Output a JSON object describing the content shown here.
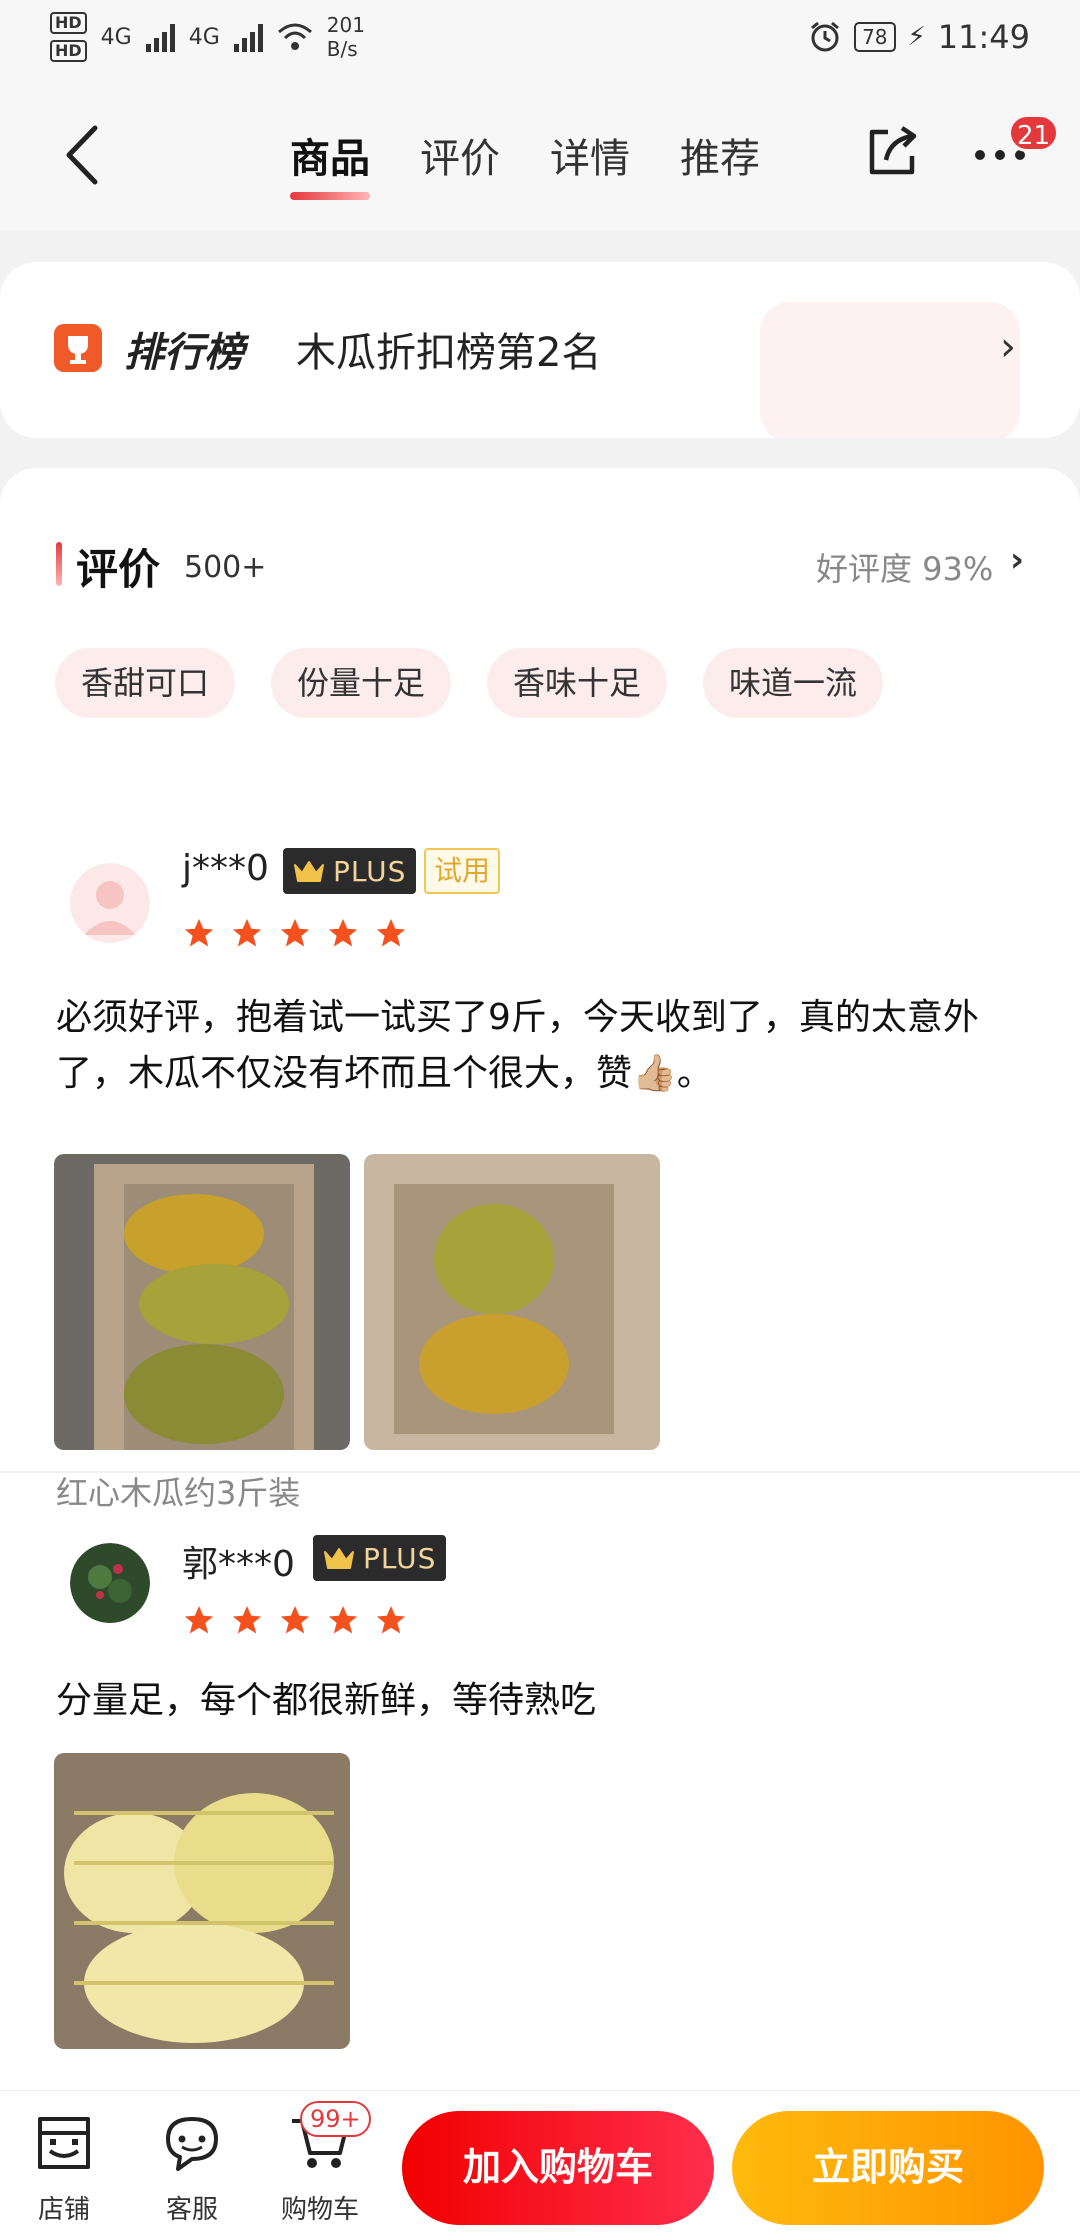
{
  "status_bar": {
    "hd1": "HD",
    "hd2": "HD",
    "sim1": "4G",
    "sim2": "4G",
    "net_speed_value": "201",
    "net_speed_unit": "B/s",
    "battery": "78",
    "time": "11:49",
    "icons": [
      "signal-icon",
      "wifi-icon",
      "alarm-icon",
      "battery-icon",
      "charging-icon"
    ]
  },
  "nav": {
    "tabs": [
      {
        "label": "商品",
        "active": true
      },
      {
        "label": "评价",
        "active": false
      },
      {
        "label": "详情",
        "active": false
      },
      {
        "label": "推荐",
        "active": false
      }
    ],
    "more_badge": "21",
    "icons": [
      "back-icon",
      "share-icon",
      "more-icon"
    ]
  },
  "ranking": {
    "logo": "排行榜",
    "text": "木瓜折扣榜第2名",
    "icons": [
      "trophy-icon",
      "chevron-right-icon"
    ]
  },
  "reviews_section": {
    "title": "评价",
    "count": "500+",
    "good_rate": "好评度 93%",
    "tags": [
      "香甜可口",
      "份量十足",
      "香味十足",
      "味道一流"
    ]
  },
  "reviews": [
    {
      "username": "j***0",
      "plus": "PLUS",
      "trial": "试用",
      "stars": 5,
      "text": "必须好评，抱着试一试买了9斤，今天收到了，真的太意外了，木瓜不仅没有坏而且个很大，赞👍🏼。",
      "spec": "红心木瓜约3斤装",
      "photos": 2
    },
    {
      "username": "郭***0",
      "plus": "PLUS",
      "stars": 5,
      "text": "分量足，每个都很新鲜，等待熟吃",
      "photos": 1
    }
  ],
  "bottom_bar": {
    "store": "店铺",
    "service": "客服",
    "cart": "购物车",
    "cart_badge": "99+",
    "add_to_cart": "加入购物车",
    "buy_now": "立即购买"
  },
  "colors": {
    "accent": "#e4393c",
    "buy": "#ff9f00",
    "star": "#f4511e"
  }
}
